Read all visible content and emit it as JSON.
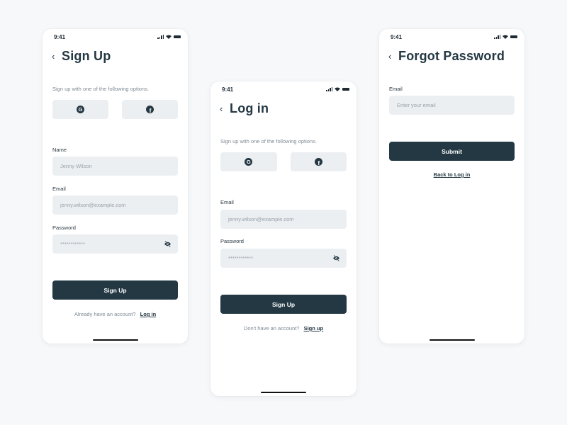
{
  "status_bar": {
    "time": "9:41"
  },
  "screens": {
    "sign_up": {
      "title": "Sign Up",
      "hint": "Sign up with one of the following options.",
      "social": [
        {
          "icon": "google-icon",
          "glyph": "G"
        },
        {
          "icon": "facebook-icon",
          "glyph": "f"
        }
      ],
      "fields": {
        "name": {
          "label": "Name",
          "placeholder": "Jenny Wilson"
        },
        "email": {
          "label": "Email",
          "placeholder": "jenny.wilson@example.com"
        },
        "password": {
          "label": "Password",
          "placeholder": "************"
        }
      },
      "submit_label": "Sign Up",
      "footer_text": "Already have an account?",
      "footer_link": "Log in"
    },
    "log_in": {
      "title": "Log in",
      "hint": "Sign up with one of the following options.",
      "social": [
        {
          "icon": "google-icon",
          "glyph": "G"
        },
        {
          "icon": "facebook-icon",
          "glyph": "f"
        }
      ],
      "fields": {
        "email": {
          "label": "Email",
          "placeholder": "jenny.wilson@example.com"
        },
        "password": {
          "label": "Password",
          "placeholder": "************"
        }
      },
      "submit_label": "Sign Up",
      "footer_text": "Don't have an account?",
      "footer_link": "Sign up"
    },
    "forgot_password": {
      "title": "Forgot Password",
      "fields": {
        "email": {
          "label": "Email",
          "placeholder": "Enter your email"
        }
      },
      "submit_label": "Submit",
      "footer_link": "Back to Log in"
    }
  },
  "colors": {
    "background": "#f6f8fa",
    "primary": "#233843",
    "field": "#eceff2",
    "muted_text": "#7d8a93"
  }
}
